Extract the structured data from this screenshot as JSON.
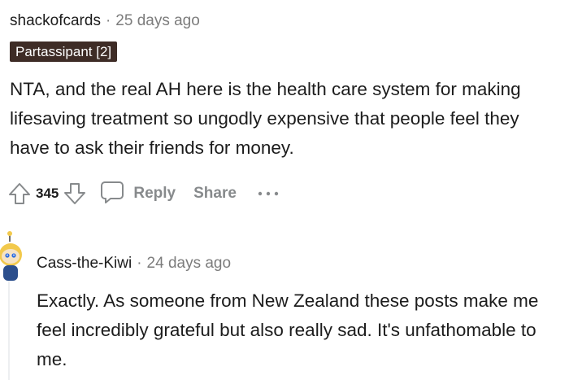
{
  "comment": {
    "author": "shackofcards",
    "separator": "·",
    "time": "25 days ago",
    "flair": "Partassipant [2]",
    "body": "NTA, and the real AH here is the health care system for making lifesaving treatment so ungodly expensive that people feel they have to ask their friends for money.",
    "score": "345",
    "actions": {
      "reply_label": "Reply",
      "share_label": "Share"
    },
    "icons": {
      "upvote": "upvote-arrow-icon",
      "downvote": "downvote-arrow-icon",
      "reply": "speech-bubble-icon",
      "more": "more-dots-icon"
    }
  },
  "reply": {
    "author": "Cass-the-Kiwi",
    "separator": "·",
    "time": "24 days ago",
    "body": "Exactly. As someone from New Zealand these posts make me feel incredibly grateful but also really sad. It's unfathomable to me.",
    "avatar": "snoo-avatar-icon"
  },
  "colors": {
    "flair_bg": "#3e2c26",
    "muted_text": "#878a8c",
    "meta_text": "#7c7c7c",
    "thread_line": "#edeff1"
  }
}
